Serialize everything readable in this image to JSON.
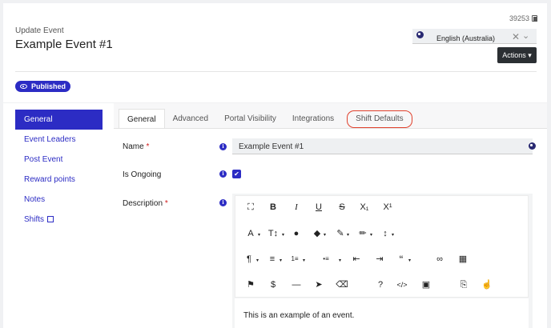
{
  "header": {
    "subtitle": "Update Event",
    "title": "Example Event #1",
    "record_id": "39253",
    "language": "English (Australia)",
    "actions_label": "Actions ▾",
    "status_badge": "Published"
  },
  "sidebar": {
    "items": [
      {
        "label": "General"
      },
      {
        "label": "Event Leaders"
      },
      {
        "label": "Post Event"
      },
      {
        "label": "Reward points"
      },
      {
        "label": "Notes"
      },
      {
        "label": "Shifts"
      }
    ]
  },
  "tabs": [
    {
      "label": "General"
    },
    {
      "label": "Advanced"
    },
    {
      "label": "Portal Visibility"
    },
    {
      "label": "Integrations"
    },
    {
      "label": "Shift Defaults"
    }
  ],
  "form": {
    "name_label": "Name",
    "name_value": "Example Event #1",
    "ongoing_label": "Is Ongoing",
    "ongoing_checked": true,
    "description_label": "Description",
    "description_value": "This is an example of an event.",
    "required_mark": "*",
    "info_glyph": "i",
    "check_glyph": "✔"
  },
  "toolbar": {
    "row1": [
      "⛶",
      "B",
      "I",
      "U",
      "S",
      "X₁",
      "X¹"
    ],
    "row2": [
      "A",
      "T↕",
      "●",
      "◆",
      "✎",
      "✏",
      "↕"
    ],
    "row3": [
      "¶",
      "≡",
      "1≡",
      "•≡",
      "⇤",
      "⇥",
      "“",
      "∞",
      "▦"
    ],
    "row4": [
      "⚑",
      "$",
      "—",
      "➤",
      "⌫",
      "?",
      "</>",
      "▣",
      "⎘",
      "☝"
    ],
    "dropdown_glyph": "▾"
  },
  "colors": {
    "accent": "#2c2cc4",
    "annotation_ring": "#e0402c",
    "actions_bg": "#2b2f33"
  }
}
